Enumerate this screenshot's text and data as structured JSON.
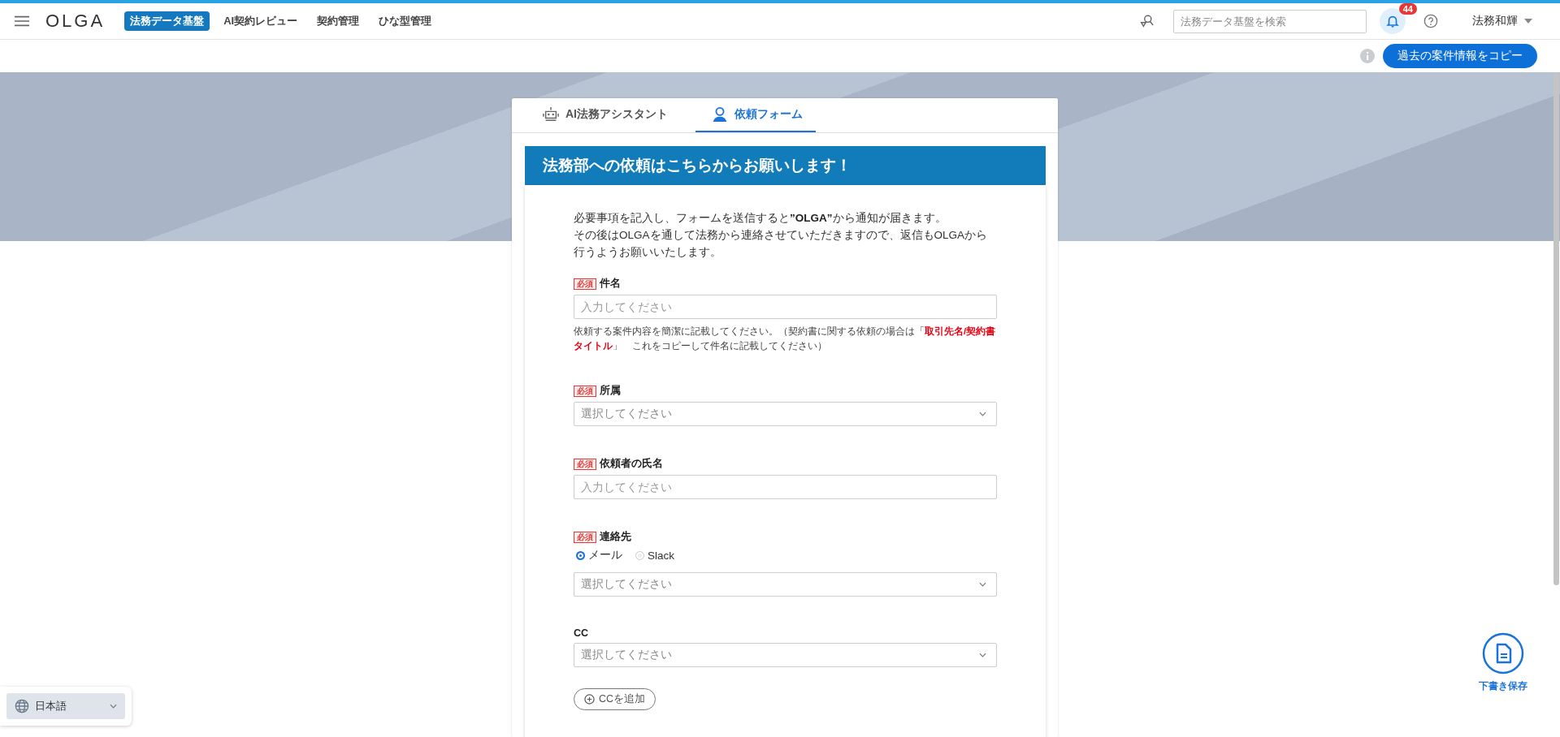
{
  "header": {
    "logo": "OLGA",
    "nav": [
      {
        "label": "法務データ基盤",
        "selected": true
      },
      {
        "label": "AI契約レビュー",
        "selected": false
      },
      {
        "label": "契約管理",
        "selected": false
      },
      {
        "label": "ひな型管理",
        "selected": false
      }
    ],
    "search": {
      "placeholder": "法務データ基盤を検索"
    },
    "notifications": {
      "count": "44"
    },
    "user": {
      "name": "法務和輝"
    }
  },
  "toolbar": {
    "copy_button": "過去の案件情報をコピー"
  },
  "tabs": [
    {
      "label": "AI法務アシスタント",
      "kind": "robot",
      "selected": false
    },
    {
      "label": "依頼フォーム",
      "kind": "person",
      "selected": true
    }
  ],
  "form": {
    "title": "法務部への依頼はこちらからお願いします！",
    "intro": [
      "必要事項を記入し、フォームを送信すると**”OLGA”**から通知が届きます。",
      "その後はOLGAを通して法務から連絡させていただきますので、返信もOLGAから行うようお願いいたします。"
    ],
    "fields": [
      {
        "kind": "text",
        "label": "件名",
        "required": true,
        "required_badge": "必須",
        "placeholder": "入力してください",
        "help": "依頼する案件内容を簡潔に記載してください。（契約書に関する依頼の場合は「**取引先名/契約書タイトル**」　これをコピーして件名に記載してください）"
      },
      {
        "kind": "select",
        "label": "所属",
        "required": true,
        "required_badge": "必須",
        "placeholder": "選択してください"
      },
      {
        "kind": "text",
        "label": "依頼者の氏名",
        "required": true,
        "required_badge": "必須",
        "placeholder": "入力してください"
      },
      {
        "kind": "select",
        "label": "連絡先",
        "required": true,
        "required_badge": "必須",
        "placeholder": "選択してください",
        "options": [
          {
            "label": "メール",
            "selected": true
          },
          {
            "label": "Slack",
            "selected": false
          }
        ]
      },
      {
        "kind": "select",
        "label": "CC",
        "required": false,
        "placeholder": "選択してください"
      }
    ],
    "add_cc_button": "CCを追加"
  },
  "language": "日本語",
  "draft_button": "下書き保存"
}
